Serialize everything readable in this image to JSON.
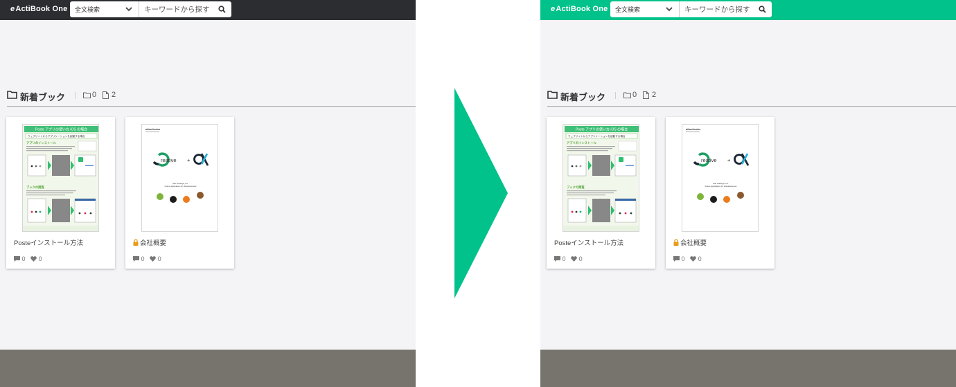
{
  "app": {
    "logo_text": "ActiBook One",
    "logo_mark": "e"
  },
  "search": {
    "scope_label": "全文検索",
    "placeholder": "キーワードから探す",
    "value": ""
  },
  "section": {
    "title": "新着ブック",
    "folder_count": "0",
    "doc_count": "2"
  },
  "books": [
    {
      "title": "Posteインストール方法",
      "locked": false,
      "comments": "0",
      "likes": "0"
    },
    {
      "title": "会社概要",
      "locked": true,
      "comments": "0",
      "likes": "0"
    }
  ],
  "thumbnail_poste": {
    "banner": "Poste アプリの使い方  iOS の場合",
    "subbanner": "ウェブサイトからアプリケーションを起動する場合",
    "heading1": "アプリのインストール",
    "heading2": "ブックの閲覧"
  },
  "thumbnail_company": {
    "brand": "atlantisstar",
    "headline_1": "reative",
    "headline_plus": "+",
    "company_line": "Star Holdings, Inc.",
    "tagline": "Future application for ubiquitousness"
  },
  "theme": {
    "before": {
      "header_color": "#2b2d31"
    },
    "after": {
      "header_color": "#00c28a"
    },
    "arrow_color": "#00c28a",
    "footer_color": "#76746c"
  },
  "icons": {
    "logo": "e-link-icon",
    "chevron": "chevron-down-icon",
    "search": "search-icon",
    "folder": "folder-icon",
    "document": "document-icon",
    "comment": "comment-icon",
    "like": "heart-icon",
    "lock": "lock-icon"
  }
}
